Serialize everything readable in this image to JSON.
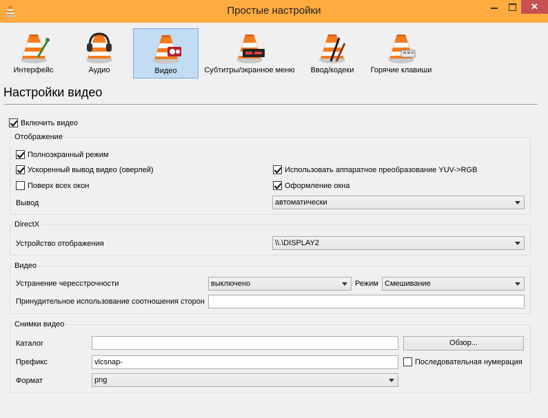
{
  "window": {
    "title": "Простые настройки",
    "icon": "vlc-cone-icon",
    "close_glyph": "✕"
  },
  "categories": [
    {
      "label": "Интерфейс",
      "icon": "interface-cone-icon",
      "selected": false
    },
    {
      "label": "Аудио",
      "icon": "audio-headphones-cone-icon",
      "selected": false
    },
    {
      "label": "Видео",
      "icon": "video-cone-icon",
      "selected": true
    },
    {
      "label": "Субтитры/экранное меню",
      "icon": "subtitles-cone-icon",
      "selected": false
    },
    {
      "label": "Ввод/кодеки",
      "icon": "input-codecs-cone-icon",
      "selected": false
    },
    {
      "label": "Горячие клавиши",
      "icon": "hotkeys-cone-icon",
      "selected": false
    }
  ],
  "page_title": "Настройки видео",
  "enable_video": {
    "label": "Включить видео",
    "checked": true
  },
  "display": {
    "title": "Отображение",
    "fullscreen": {
      "label": "Полноэкранный режим",
      "checked": true
    },
    "overlay": {
      "label": "Ускоренный вывод видео (оверлей)",
      "checked": true
    },
    "on_top": {
      "label": "Поверх всех окон",
      "checked": false
    },
    "yuv_rgb": {
      "label": "Использовать аппаратное преобразование YUV->RGB",
      "checked": true
    },
    "decorations": {
      "label": "Оформление окна",
      "checked": true
    },
    "output_label": "Вывод",
    "output_value": "автоматически"
  },
  "directx": {
    "title": "DirectX",
    "device_label": "Устройство отображения",
    "device_value": "\\\\.\\DISPLAY2"
  },
  "video": {
    "title": "Видео",
    "deinterlace_label": "Устранение чересстрочности",
    "deinterlace_value": "выключено",
    "mode_label": "Режим",
    "mode_value": "Смешивание",
    "aspect_label": "Принудительное использование соотношения сторон",
    "aspect_value": ""
  },
  "snapshots": {
    "title": "Снимки видео",
    "dir_label": "Каталог",
    "dir_value": "",
    "browse_label": "Обзор...",
    "prefix_label": "Префикс",
    "prefix_value": "vlcsnap-",
    "sequential": {
      "label": "Последовательная нумерация",
      "checked": false
    },
    "format_label": "Формат",
    "format_value": "png"
  },
  "colors": {
    "titlebar": "#ffab40",
    "selected_category": "#c2dcf3",
    "close_button": "#c75050",
    "cone_orange": "#f47c1e"
  }
}
